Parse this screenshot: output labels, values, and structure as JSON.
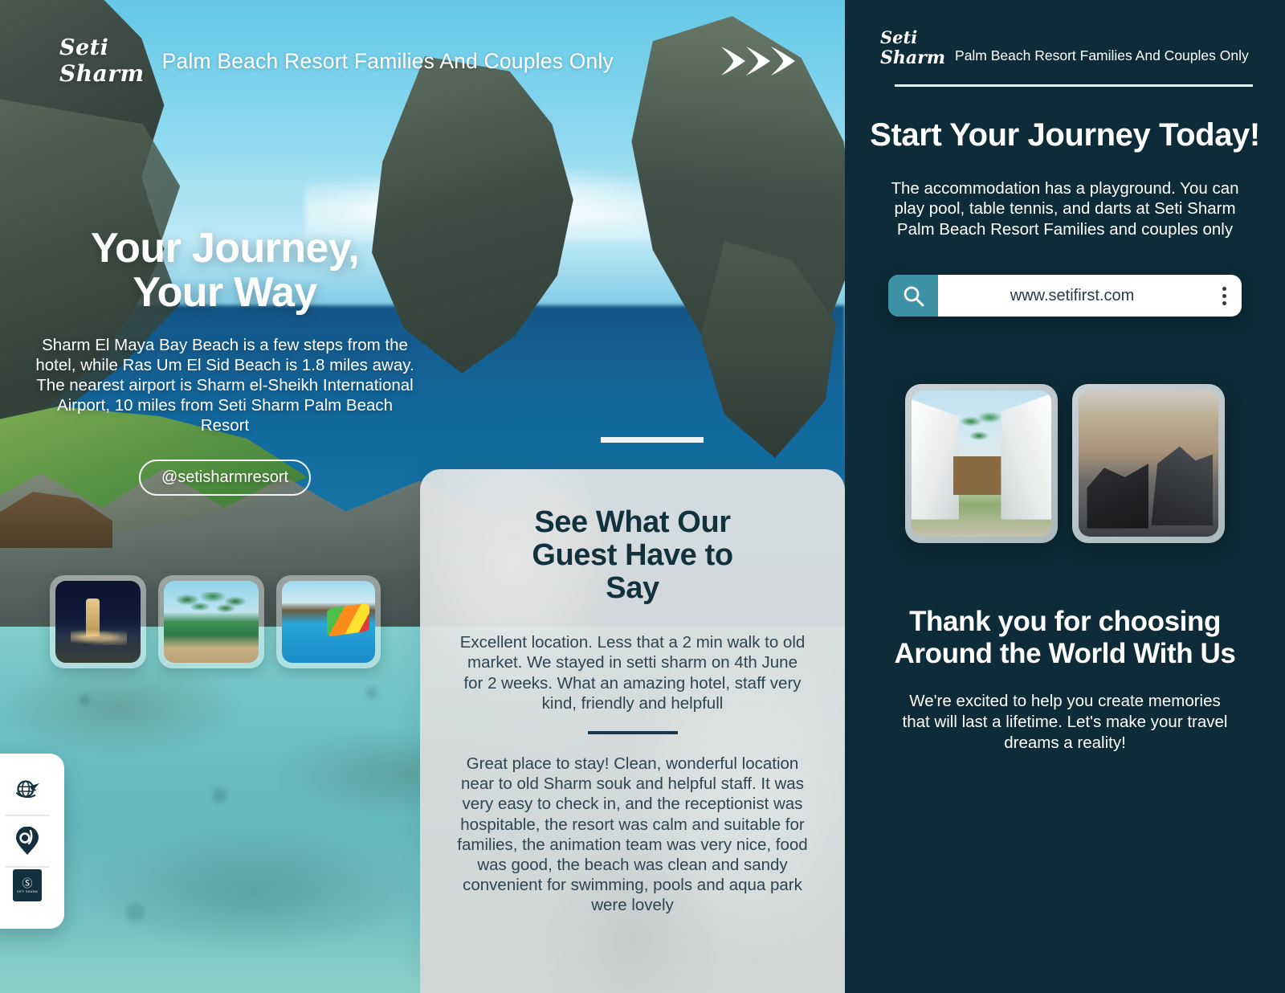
{
  "brand": {
    "logo_line1": "Seti",
    "logo_line2": "Sharm",
    "tagline": "Palm Beach Resort Families And Couples Only",
    "accent_teal": "#3d92a5",
    "dark_teal": "#0d2b38",
    "card_grey": "#d4d6d6",
    "heading_navy": "#12313f"
  },
  "left_panel": {
    "arrows_icon": "triple-chevron-icon",
    "hero": {
      "title_line1": "Your Journey,",
      "title_line2": "Your Way",
      "body": "Sharm El Maya Bay Beach is a few steps from the hotel, while Ras Um El Sid Beach is 1.8 miles away. The nearest airport is Sharm el-Sheikh International Airport, 10 miles from Seti Sharm Palm Beach Resort",
      "handle": "@setisharmresort"
    },
    "thumbnails": [
      {
        "name": "mosque-at-night-thumbnail"
      },
      {
        "name": "palm-trees-beach-thumbnail"
      },
      {
        "name": "aqua-park-pool-thumbnail"
      }
    ],
    "rail": [
      {
        "icon": "globe-plane-icon"
      },
      {
        "icon": "location-pin-icon"
      },
      {
        "icon": "brand-badge-icon",
        "badge_top": "Ⓢ",
        "badge_bottom": "SETI SHARM"
      }
    ],
    "testimonial": {
      "title_line1": "See What Our",
      "title_line2": "Guest Have to",
      "title_line3": "Say",
      "review_1": "Excellent location. Less that a 2 min walk to old market. We stayed in setti sharm on 4th June for 2 weeks. What an amazing hotel, staff very kind, friendly and helpfull",
      "review_2": "Great place to stay! Clean, wonderful location near to old Sharm souk and helpful staff. It was very easy to check in, and the receptionist was hospitable, the resort was calm and suitable for families, the animation team was very nice, food was good, the beach was clean and sandy convenient for swimming, pools and aqua park were lovely"
    }
  },
  "right_panel": {
    "title": "Start Your Journey Today!",
    "body": "The accommodation has a playground. You can play pool, table tennis, and darts at Seti Sharm Palm Beach Resort Families and couples only",
    "url_widget": {
      "search_icon": "search-icon",
      "url": "www.setifirst.com",
      "menu_icon": "kebab-menu-icon"
    },
    "photos": [
      {
        "name": "resort-villas-photo"
      },
      {
        "name": "gym-interior-photo"
      }
    ],
    "thanks_title": "Thank you for choosing Around the World With Us",
    "thanks_body": "We're excited to help you create memories that will last a lifetime. Let's make your travel dreams a reality!"
  }
}
